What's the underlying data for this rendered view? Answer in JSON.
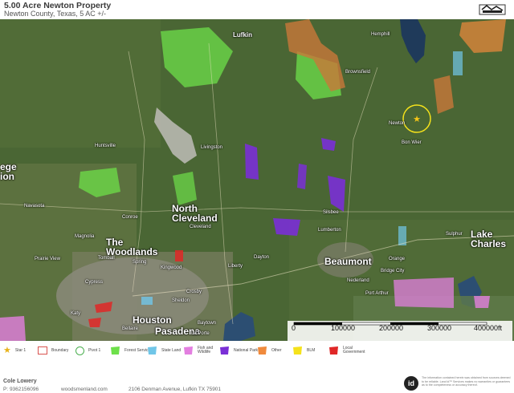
{
  "header": {
    "title": "5.00 Acre Newton Property",
    "subtitle": "Newton County, Texas, 5 AC +/-",
    "logo_text": "LAND ID"
  },
  "map": {
    "places": [
      {
        "id": "lufkin",
        "label": "Lufkin",
        "size": "mid"
      },
      {
        "id": "hemphill",
        "label": "Hemphill",
        "size": "small"
      },
      {
        "id": "brownsfield",
        "label": "Brownsfield",
        "size": "small"
      },
      {
        "id": "huntsville",
        "label": "Huntsville",
        "size": "small"
      },
      {
        "id": "livingston",
        "label": "Livingston",
        "size": "small"
      },
      {
        "id": "newton",
        "label": "Newton",
        "size": "small"
      },
      {
        "id": "bon-wier",
        "label": "Bon Wier",
        "size": "small"
      },
      {
        "id": "north-cleveland",
        "label": "North\nCleveland",
        "size": "big"
      },
      {
        "id": "cleveland",
        "label": "Cleveland",
        "size": "small"
      },
      {
        "id": "navasota",
        "label": "Navasota",
        "size": "small"
      },
      {
        "id": "conroe",
        "label": "Conroe",
        "size": "small"
      },
      {
        "id": "magnolia",
        "label": "Magnolia",
        "size": "small"
      },
      {
        "id": "the-woodlands",
        "label": "The\nWoodlands",
        "size": "big"
      },
      {
        "id": "silsbee",
        "label": "Silsbee",
        "size": "small"
      },
      {
        "id": "lumberton",
        "label": "Lumberton",
        "size": "small"
      },
      {
        "id": "beaumont",
        "label": "Beaumont",
        "size": "big"
      },
      {
        "id": "orange",
        "label": "Orange",
        "size": "small"
      },
      {
        "id": "lake-charles",
        "label": "Lake\nCharles",
        "size": "big"
      },
      {
        "id": "sulphur",
        "label": "Sulphur",
        "size": "small"
      },
      {
        "id": "bridge-city",
        "label": "Bridge City",
        "size": "small"
      },
      {
        "id": "nederland",
        "label": "Nederland",
        "size": "small"
      },
      {
        "id": "port-arthur",
        "label": "Port Arthur",
        "size": "small"
      },
      {
        "id": "prairie-view",
        "label": "Prairie View",
        "size": "small"
      },
      {
        "id": "tomball",
        "label": "Tomball",
        "size": "small"
      },
      {
        "id": "cypress",
        "label": "Cypress",
        "size": "small"
      },
      {
        "id": "spring",
        "label": "Spring",
        "size": "small"
      },
      {
        "id": "kingwood",
        "label": "Kingwood",
        "size": "small"
      },
      {
        "id": "liberty",
        "label": "Liberty",
        "size": "small"
      },
      {
        "id": "dayton",
        "label": "Dayton",
        "size": "small"
      },
      {
        "id": "crosby",
        "label": "Crosby",
        "size": "small"
      },
      {
        "id": "houston",
        "label": "Houston",
        "size": "big"
      },
      {
        "id": "pasadena",
        "label": "Pasadena",
        "size": "big"
      },
      {
        "id": "baytown",
        "label": "Baytown",
        "size": "small"
      },
      {
        "id": "katy",
        "label": "Katy",
        "size": "small"
      },
      {
        "id": "bellaire",
        "label": "Bellaire",
        "size": "small"
      },
      {
        "id": "la-porte",
        "label": "La Porte",
        "size": "small"
      },
      {
        "id": "sheldon",
        "label": "Sheldon",
        "size": "small"
      },
      {
        "id": "ege",
        "label": "ege\nion",
        "size": "big"
      }
    ],
    "subject_marker": "star-icon"
  },
  "scale": {
    "labels": [
      "0",
      "100000",
      "200000",
      "300000",
      "400000ft"
    ]
  },
  "legend": {
    "items": [
      {
        "label": "Star 1",
        "color": "#e8b21a",
        "icon": "star-icon"
      },
      {
        "label": "Boundary",
        "color": "#d9534f",
        "icon": "boundary-icon"
      },
      {
        "label": "Pivot 1",
        "color": "#4caf50",
        "icon": "circle-icon"
      },
      {
        "label": "Forest Servic",
        "color": "#6ee04a",
        "icon": "forest-service-swatch"
      },
      {
        "label": "State Land",
        "color": "#70c6e8",
        "icon": "state-land-swatch"
      },
      {
        "label": "Fish and Wildlife",
        "color": "#e37fe0",
        "icon": "fish-wildlife-swatch"
      },
      {
        "label": "National Park",
        "color": "#7a2fd6",
        "icon": "national-park-swatch"
      },
      {
        "label": "Other",
        "color": "#f08a3c",
        "icon": "other-swatch"
      },
      {
        "label": "BLM",
        "color": "#f5e21b",
        "icon": "blm-swatch"
      },
      {
        "label": "Local Government",
        "color": "#e02727",
        "icon": "local-government-swatch"
      }
    ]
  },
  "footer": {
    "agent_name": "Cole Lowery",
    "phone": "P: 9362156096",
    "website": "woodsmenland.com",
    "address": "2106 Denman Avenue, Lufkin TX 75901",
    "disclaimer": "The information contained herein was obtained from sources deemed to be reliable. Land id™ Services makes no warranties or guarantees as to the completeness or accuracy thereof."
  }
}
